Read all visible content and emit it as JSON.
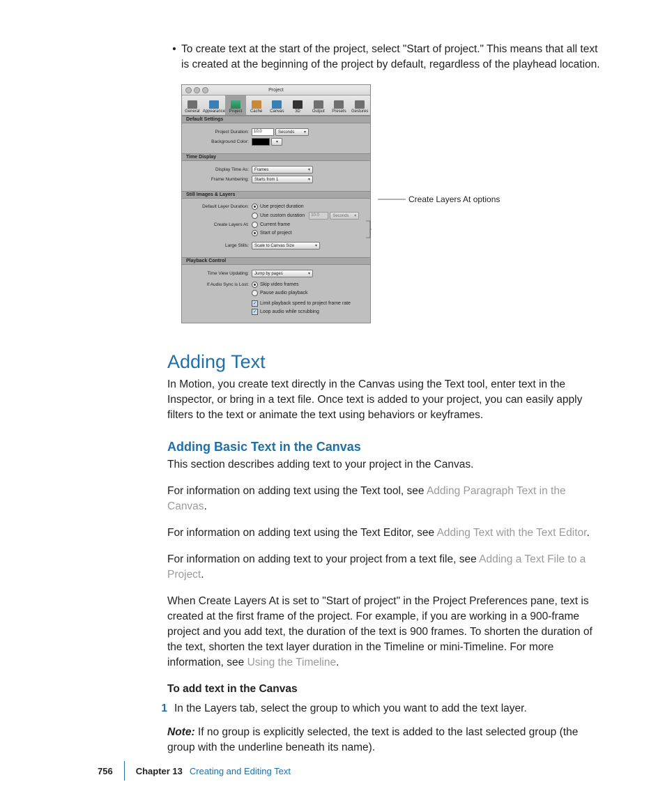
{
  "bullet": "To create text at the start of the project, select \"Start of project.\" This means that all text is created at the beginning of the project by default, regardless of the playhead location.",
  "pref": {
    "title": "Project",
    "tabs": [
      "General",
      "Appearance",
      "Project",
      "Cache",
      "Canvas",
      "3D",
      "Output",
      "Presets",
      "Gestures"
    ],
    "sections": {
      "default": "Default Settings",
      "time": "Time Display",
      "still": "Still Images & Layers",
      "playback": "Playback Control"
    },
    "labels": {
      "projDur": "Project Duration:",
      "projDurVal": "10.0",
      "projDurUnit": "Seconds",
      "bgColor": "Background Color:",
      "dispTime": "Display Time As:",
      "dispTimeVal": "Frames",
      "frameNum": "Frame Numbering:",
      "frameNumVal": "Starts from 1",
      "defLayerDur": "Default Layer Duration:",
      "useProj": "Use project duration",
      "useCustom": "Use custom duration",
      "customVal": "10.0",
      "customUnit": "Seconds",
      "createLayers": "Create Layers At:",
      "curFrame": "Current frame",
      "startProj": "Start of project",
      "largeStills": "Large Stills:",
      "largeStillsVal": "Scale to Canvas Size",
      "timeView": "Time View Updating:",
      "timeViewVal": "Jump by pages",
      "audioLost": "If Audio Sync is Lost:",
      "skipVid": "Skip video frames",
      "pauseAudio": "Pause audio playback",
      "limitPb": "Limit playback speed to project frame rate",
      "loopAudio": "Loop audio while scrubbing"
    }
  },
  "callout": "Create Layers At options",
  "h1": "Adding Text",
  "intro": "In Motion, you create text directly in the Canvas using the Text tool, enter text in the Inspector, or bring in a text file. Once text is added to your project, you can easily apply filters to the text or animate the text using behaviors or keyframes.",
  "h2": "Adding Basic Text in the Canvas",
  "p1": "This section describes adding text to your project in the Canvas.",
  "p2a": "For information on adding text using the Text tool, see ",
  "p2link": "Adding Paragraph Text in the Canvas",
  "p3a": "For information on adding text using the Text Editor, see ",
  "p3link": "Adding Text with the Text Editor",
  "p4a": "For information on adding text to your project from a text file, see ",
  "p4link": "Adding a Text File to a Project",
  "p5a": "When Create Layers At is set to \"Start of project\" in the Project Preferences pane, text is created at the first frame of the project. For example, if you are working in a 900-frame project and you add text, the duration of the text is 900 frames. To shorten the duration of the text, shorten the text layer duration in the Timeline or mini-Timeline. For more information, see ",
  "p5link": "Using the Timeline",
  "taskHead": "To add text in the Canvas",
  "step1": "In the Layers tab, select the group to which you want to add the text layer.",
  "noteLabel": "Note:",
  "noteText": "  If no group is explicitly selected, the text is added to the last selected group (the group with the underline beneath its name).",
  "footer": {
    "page": "756",
    "chapter": "Chapter 13",
    "title": "Creating and Editing Text"
  }
}
